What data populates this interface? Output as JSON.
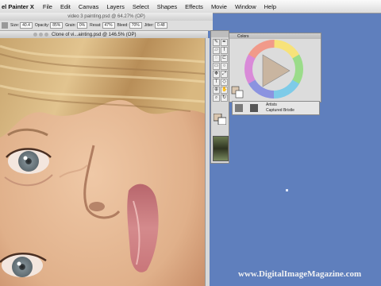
{
  "menubar": {
    "app": "el Painter X",
    "items": [
      "File",
      "Edit",
      "Canvas",
      "Layers",
      "Select",
      "Shapes",
      "Effects",
      "Movie",
      "Window",
      "Help"
    ]
  },
  "second_window_title": "video 3 painting.psd @ 64.27% (OP)",
  "property_bar": {
    "fields": [
      {
        "label": "Size:",
        "value": "40.4"
      },
      {
        "label": "Opacity:",
        "value": "85%"
      },
      {
        "label": "Grain:",
        "value": "0%"
      },
      {
        "label": "Resat:",
        "value": "47%"
      },
      {
        "label": "Bleed:",
        "value": "70%"
      },
      {
        "label": "Jitter:",
        "value": "0.48"
      }
    ]
  },
  "document": {
    "title": "Clone of vi...ainting.psd @ 146.5% (OP)"
  },
  "colors_panel": {
    "title": "Colors"
  },
  "brush_selector": {
    "category": "Artists",
    "variant": "Captured Bristle"
  },
  "watermark": "www.DigitalImageMagazine.com",
  "colors": {
    "desktop": "#5f7fbd",
    "skin": "#e4b894",
    "hair": "#d2b07a",
    "iris": "#7d8a90",
    "lips": "#c9767a"
  }
}
